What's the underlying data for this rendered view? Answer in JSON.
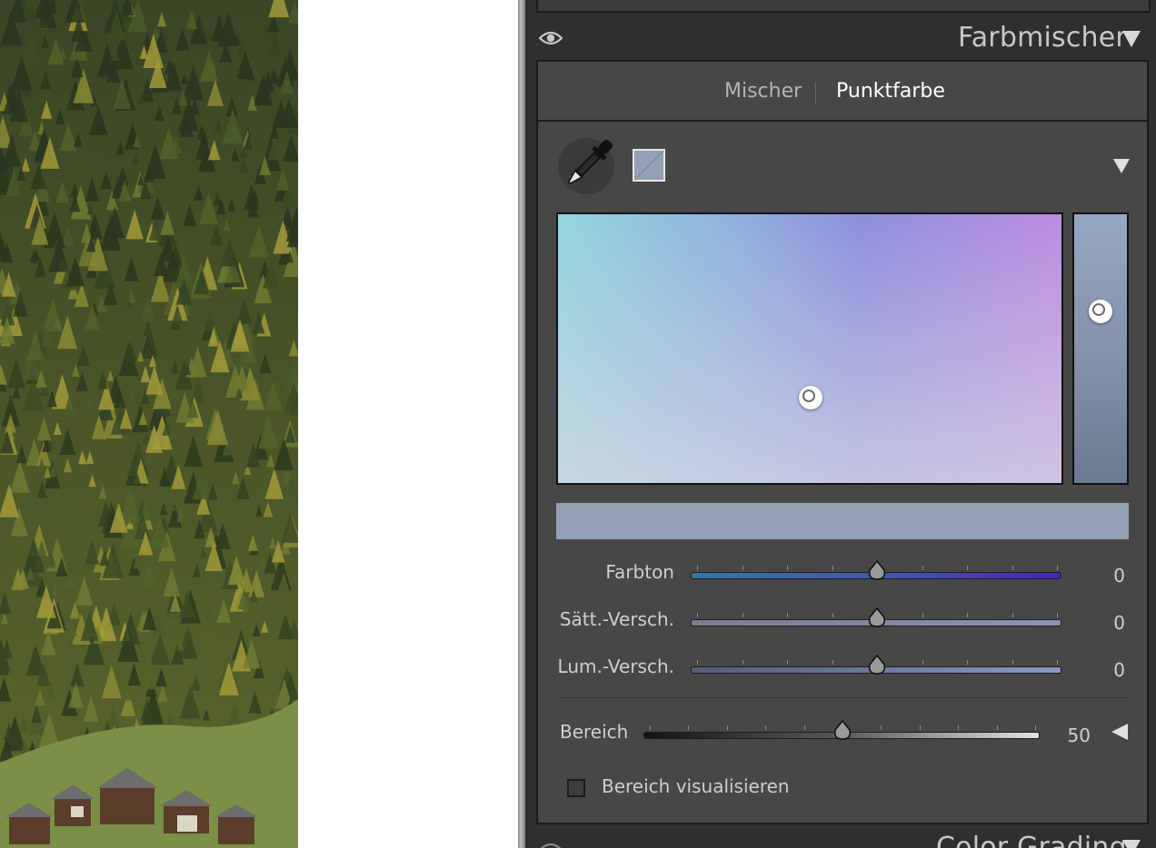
{
  "panel": {
    "section_title": "Farbmischer",
    "next_section_title": "Color Grading"
  },
  "tabs": [
    {
      "label": "Mischer",
      "active": false
    },
    {
      "label": "Punktfarbe",
      "active": true
    }
  ],
  "sample_color": "#94a0b3",
  "sliders": [
    {
      "label": "Farbton",
      "value": "0",
      "position": 0.5
    },
    {
      "label": "Sätt.-Versch.",
      "value": "0",
      "position": 0.5
    },
    {
      "label": "Lum.-Versch.",
      "value": "0",
      "position": 0.5
    }
  ],
  "range": {
    "label": "Bereich",
    "value": "50",
    "position": 0.5
  },
  "visualize": {
    "label": "Bereich visualisieren",
    "checked": false
  },
  "colors": {
    "panel_bg": "#2f2f2f",
    "section_bg": "#474747",
    "text": "#cfcfcf",
    "active_text": "#ffffff"
  }
}
